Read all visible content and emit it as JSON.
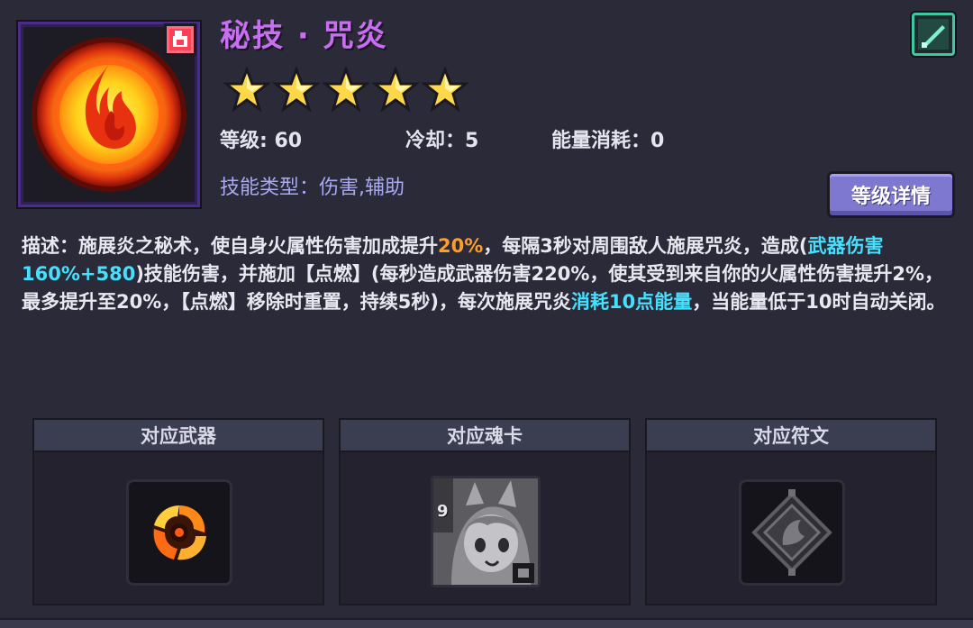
{
  "skill": {
    "name": "秘技 · 咒炎",
    "stars": 5,
    "level_label": "等级: 60",
    "cooldown_label": "冷却：5",
    "energy_label": "能量消耗：0",
    "type_label": "技能类型：伤害,辅助",
    "icon": "fire-orb-icon",
    "element_badge": "fire-element-icon"
  },
  "buttons": {
    "level_detail": "等级详情"
  },
  "description": {
    "p1": "描述：施展炎之秘术，使自身火属性伤害加成提升",
    "h1": "20%",
    "p2": "，每隔3秒对周围敌人施展咒炎，造成(",
    "h2": "武器伤害160%+580",
    "p3": ")技能伤害，并施加【点燃】(每秒造成武器伤害220%，使其受到来自你的火属性伤害提升2%，最多提升至20%，【点燃】移除时重置，持续5秒)，每次施展咒炎",
    "h3": "消耗10点能量",
    "p4": "，当能量低于10时自动关闭。"
  },
  "sections": {
    "weapon": {
      "title": "对应武器",
      "icon": "fire-weapon-icon"
    },
    "soulcard": {
      "title": "对应魂卡",
      "icon": "soul-card-portrait",
      "card_number": "9"
    },
    "rune": {
      "title": "对应符文",
      "icon": "rune-icon"
    }
  },
  "colors": {
    "skill_name": "#c86ef0",
    "highlight_orange": "#ff9c2a",
    "highlight_cyan": "#46e0ff",
    "button": "#7f78d0",
    "weapon_type": "#3fc6a2"
  }
}
